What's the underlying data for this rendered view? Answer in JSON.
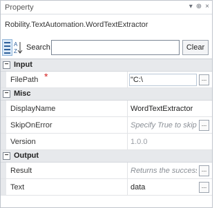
{
  "panel": {
    "title": "Property",
    "controls": [
      "▾",
      "⊕",
      "×"
    ],
    "type_name": "Robility.TextAutomation.WordTextExtractor"
  },
  "toolbar": {
    "search_label": "Search:",
    "search_value": "",
    "clear_label": "Clear"
  },
  "categories": {
    "input": {
      "label": "Input",
      "expander": "⊟"
    },
    "misc": {
      "label": "Misc",
      "expander": "⊟"
    },
    "output": {
      "label": "Output",
      "expander": "⊟"
    }
  },
  "properties": {
    "filepath": {
      "name": "FilePath",
      "required_mark": "*",
      "value": "\"C:\\",
      "value_tail": "\\",
      "ellipsis": "..."
    },
    "displayname": {
      "name": "DisplayName",
      "value": "WordTextExtractor"
    },
    "skiponerror": {
      "name": "SkipOnError",
      "value": "Specify True to skip errors d",
      "ellipsis": "..."
    },
    "version": {
      "name": "Version",
      "value": "1.0.0"
    },
    "result": {
      "name": "Result",
      "value": "Returns the success state of",
      "ellipsis": "..."
    },
    "text": {
      "name": "Text",
      "value": "data",
      "ellipsis": "..."
    }
  },
  "colors": {
    "required": "#d42020",
    "category_bg": "#e7e9ec",
    "accent": "#2d5f9a"
  }
}
